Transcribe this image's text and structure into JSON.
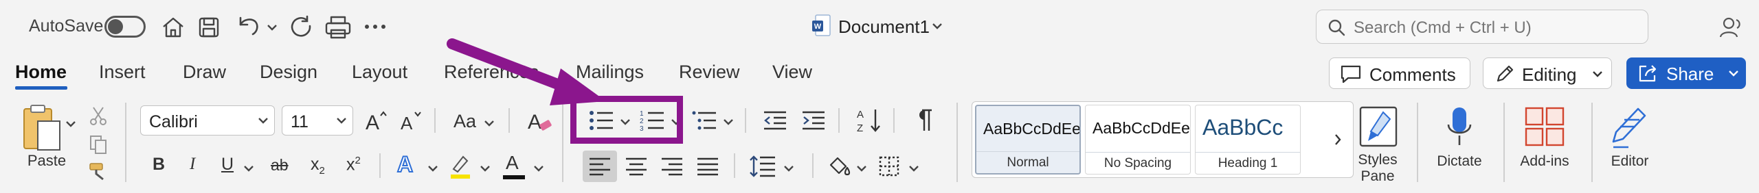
{
  "titlebar": {
    "autosave_label": "AutoSave",
    "doc_title": "Document1",
    "search_placeholder": "Search (Cmd + Ctrl + U)"
  },
  "tabs": [
    {
      "label": "Home",
      "active": true
    },
    {
      "label": "Insert"
    },
    {
      "label": "Draw"
    },
    {
      "label": "Design"
    },
    {
      "label": "Layout"
    },
    {
      "label": "References"
    },
    {
      "label": "Mailings"
    },
    {
      "label": "Review"
    },
    {
      "label": "View"
    }
  ],
  "actions": {
    "comments_label": "Comments",
    "editing_label": "Editing",
    "share_label": "Share"
  },
  "clipboard": {
    "paste_label": "Paste"
  },
  "font": {
    "family": "Calibri",
    "size": "11",
    "case_label": "Aa",
    "bold": "B",
    "italic": "I",
    "underline": "U",
    "strike": "ab",
    "subscript": "x",
    "subscript_sub": "2",
    "superscript": "x",
    "superscript_sup": "2",
    "text_effects": "A",
    "font_color_glyph": "A",
    "highlight_color": "#f7e300",
    "font_color": "#111111"
  },
  "styles": [
    {
      "sample": "AaBbCcDdEe",
      "name": "Normal",
      "selected": true
    },
    {
      "sample": "AaBbCcDdEe",
      "name": "No Spacing"
    },
    {
      "sample": "AaBbCc",
      "name": "Heading 1"
    }
  ],
  "panes": {
    "styles_pane_line1": "Styles",
    "styles_pane_line2": "Pane",
    "dictate": "Dictate",
    "addins": "Add-ins",
    "editor": "Editor"
  },
  "annotation": {
    "color": "#8b168d"
  }
}
